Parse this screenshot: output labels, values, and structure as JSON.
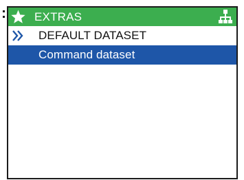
{
  "header": {
    "title": "EXTRAS",
    "left_icon": "star-icon",
    "right_icon": "hierarchy-icon"
  },
  "menu": {
    "items": [
      {
        "label": "DEFAULT DATASET",
        "icon": "double-chevron-right-icon",
        "selected": false
      },
      {
        "label": "Command dataset",
        "icon": "",
        "selected": true
      }
    ]
  },
  "colors": {
    "header_bg": "#3cae4f",
    "selected_bg": "#1e56a8",
    "chevron": "#1e56a8",
    "border": "#1a1a1a"
  }
}
